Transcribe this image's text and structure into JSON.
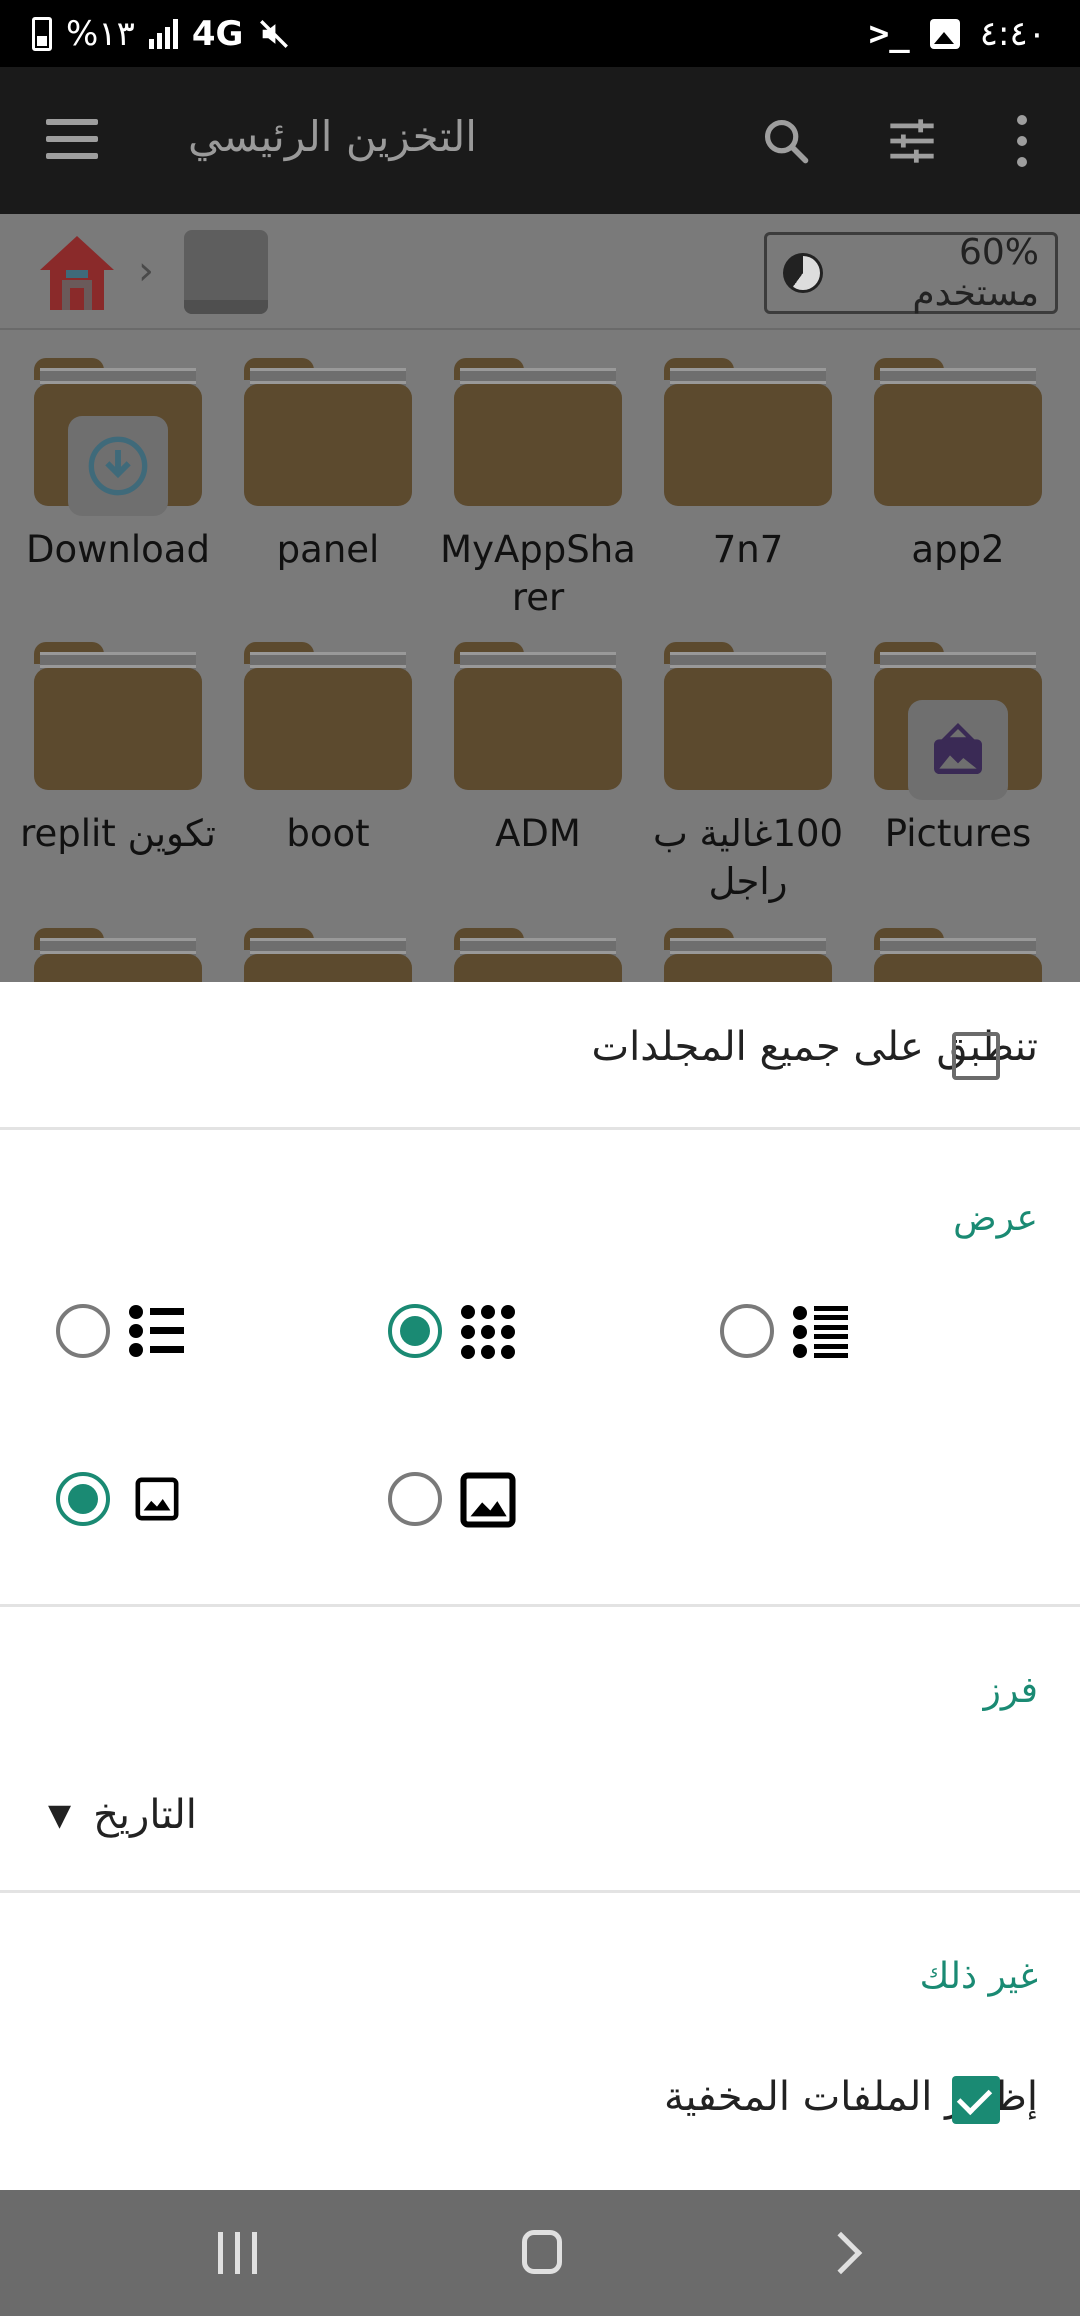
{
  "status_bar": {
    "battery": "%١٣",
    "network": "4G",
    "time": "٤:٤٠"
  },
  "app_bar": {
    "title": "التخزين الرئيسي",
    "icons": [
      "menu-icon",
      "search-icon",
      "tune-icon",
      "more-vert-icon"
    ]
  },
  "breadcrumb": {
    "usage_label": "60% مستخدم",
    "usage_percent": 60
  },
  "folders": [
    {
      "name": "Download",
      "badge": "download"
    },
    {
      "name": "panel"
    },
    {
      "name": "MyAppSharer"
    },
    {
      "name": "7n7"
    },
    {
      "name": "app2"
    },
    {
      "name": "تكوين replit"
    },
    {
      "name": "boot"
    },
    {
      "name": "ADM"
    },
    {
      "name": "100غالية ب راجل"
    },
    {
      "name": "Pictures",
      "badge": "image"
    }
  ],
  "sheet": {
    "apply_all_label": "تنطبق على جميع المجلدات",
    "apply_all_checked": false,
    "view_header": "عرض",
    "view_options": [
      {
        "icon": "list-icon",
        "selected": false
      },
      {
        "icon": "grid-icon",
        "selected": true
      },
      {
        "icon": "detailed-list-icon",
        "selected": false
      }
    ],
    "thumb_options": [
      {
        "icon": "small-thumbnail-icon",
        "selected": true
      },
      {
        "icon": "large-thumbnail-icon",
        "selected": false
      }
    ],
    "sort_header": "فرز",
    "sort_value": "التاريخ",
    "other_header": "غير ذلك",
    "show_hidden_label": "إظهار الملفات المخفية",
    "show_hidden_checked": true
  },
  "colors": {
    "accent": "#1a8a73",
    "folder": "#5c4a2e",
    "overlay_bg": "#7a7a7a"
  }
}
